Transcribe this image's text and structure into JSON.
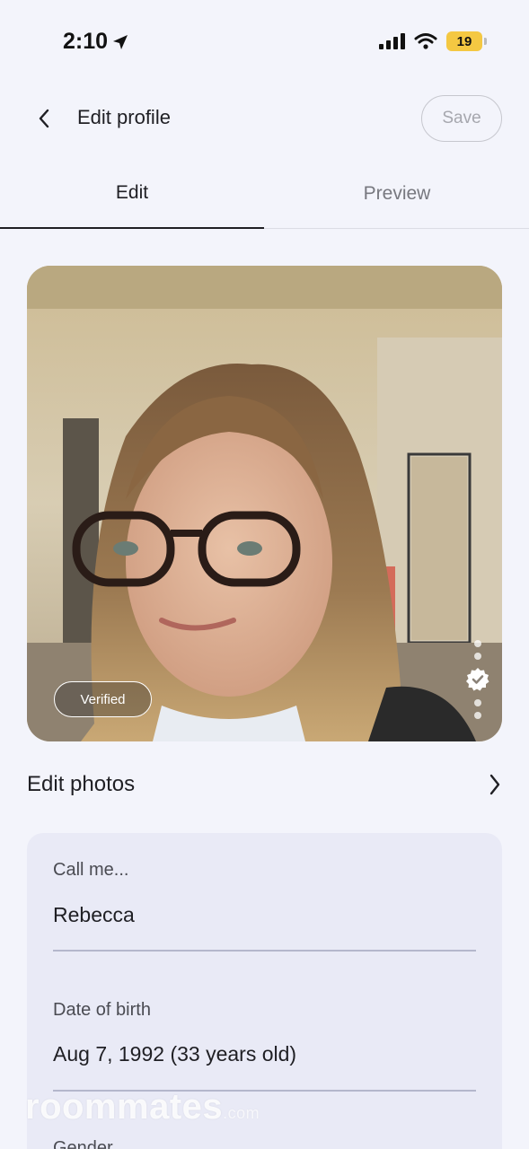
{
  "status_bar": {
    "time": "2:10",
    "battery": "19"
  },
  "header": {
    "title": "Edit profile",
    "save_label": "Save"
  },
  "tabs": [
    {
      "label": "Edit",
      "active": true
    },
    {
      "label": "Preview",
      "active": false
    }
  ],
  "photo": {
    "badge": "Verified",
    "dots_count": 4
  },
  "edit_photos": {
    "label": "Edit photos"
  },
  "form": {
    "fields": [
      {
        "label": "Call me...",
        "value": "Rebecca"
      },
      {
        "label": "Date of birth",
        "value": "Aug 7, 1992 (33 years old)"
      },
      {
        "label": "Gender",
        "value": ""
      }
    ]
  },
  "watermark": {
    "brand": "roommates",
    "suffix": ".com"
  },
  "colors": {
    "background": "#f3f4fb",
    "card": "#e9eaf6",
    "battery": "#f4c842",
    "text": "#1f1f24"
  }
}
